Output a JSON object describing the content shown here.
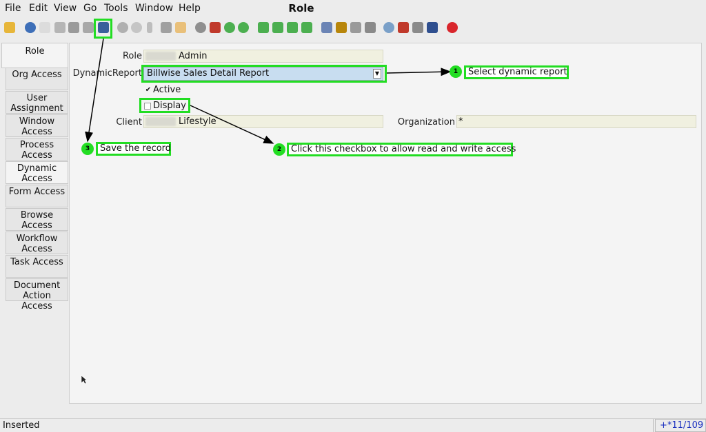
{
  "menu": {
    "file": "File",
    "edit": "Edit",
    "view": "View",
    "go": "Go",
    "tools": "Tools",
    "window": "Window",
    "help": "Help"
  },
  "window_title": "Role",
  "toolbar_icons": [
    "undo-icon",
    "help-icon",
    "new-icon",
    "copy-icon",
    "delete-icon",
    "delete-selection-icon",
    "save-icon",
    "refresh-icon",
    "find-icon",
    "attachment-icon",
    "chat-icon",
    "history-icon",
    "menu-icon",
    "home-icon",
    "back-icon",
    "forward-icon",
    "first-icon",
    "previous-icon",
    "next-icon",
    "last-icon",
    "report-icon",
    "archive-icon",
    "print-preview-icon",
    "print-icon",
    "zoom-across-icon",
    "active-workflows-icon",
    "requests-icon",
    "product-info-icon",
    "exit-icon"
  ],
  "tabs": [
    "Role",
    "Org Access",
    "User Assignment",
    "Window Access",
    "Process Access",
    "Dynamic Access",
    "Form Access",
    "Browse Access",
    "Workflow Access",
    "Task Access",
    "Document Action Access"
  ],
  "form": {
    "role_label": "Role",
    "role_value": "Admin",
    "dynamic_report_label": "DynamicReport",
    "dynamic_report_value": "Billwise Sales Detail Report",
    "active_label": "Active",
    "active_checked": true,
    "display_label": "Display",
    "display_checked": false,
    "client_label": "Client",
    "client_value": "Lifestyle",
    "organization_label": "Organization",
    "organization_value": "*"
  },
  "annotations": {
    "step1": {
      "number": "1",
      "text": "Select dynamic report"
    },
    "step2": {
      "number": "2",
      "text": "Click this checkbox to allow read and write access"
    },
    "step3": {
      "number": "3",
      "text": "Save the record"
    }
  },
  "status": {
    "message": "Inserted",
    "record_info": "+*11/109"
  },
  "colors": {
    "highlight": "#22dd22",
    "selected_field": "#c8ddf0",
    "readonly_field": "#f0f0e0"
  }
}
